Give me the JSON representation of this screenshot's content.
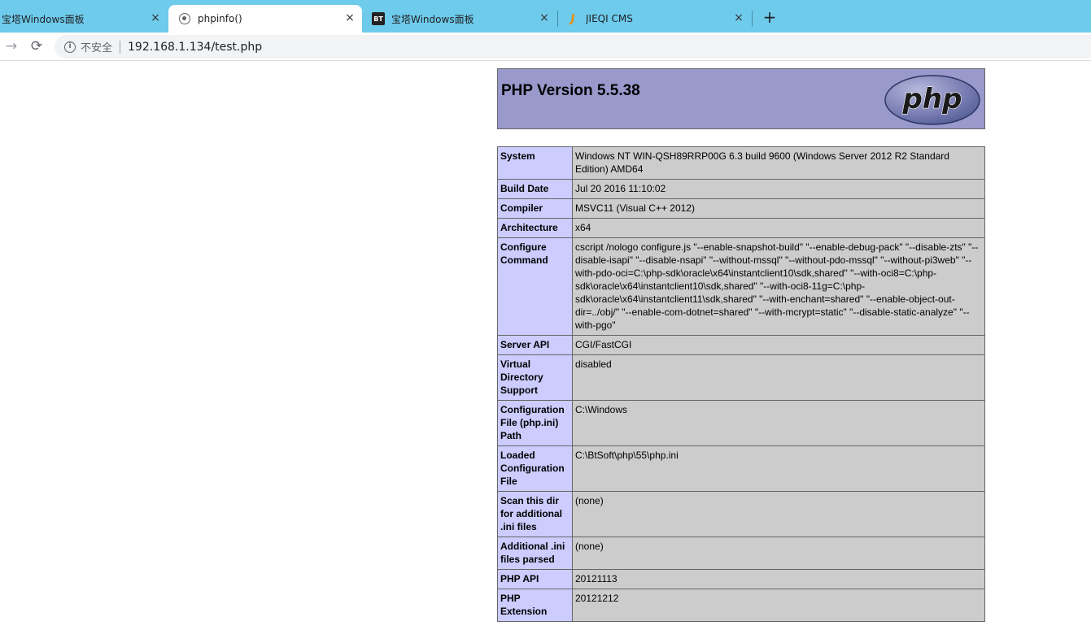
{
  "tabs": [
    {
      "title": "宝塔Windows面板",
      "icon": "none"
    },
    {
      "title": "phpinfo()",
      "icon": "globe-icon"
    },
    {
      "title": "宝塔Windows面板",
      "icon": "bt-icon"
    },
    {
      "title": "JIEQI CMS",
      "icon": "jieqi-icon"
    }
  ],
  "icons": {
    "close": "×",
    "new_tab": "+",
    "back": "←",
    "forward": "→",
    "reload": "⟳",
    "info": "i",
    "bt": "BT",
    "jieqi": "J"
  },
  "toolbar": {
    "security_label": "不安全",
    "url": "192.168.1.134/test.php"
  },
  "page": {
    "title": "PHP Version 5.5.38",
    "logo_text": "php",
    "rows": [
      {
        "key": "System",
        "value": "Windows NT WIN-QSH89RRP00G 6.3 build 9600 (Windows Server 2012 R2 Standard Edition) AMD64"
      },
      {
        "key": "Build Date",
        "value": "Jul 20 2016 11:10:02"
      },
      {
        "key": "Compiler",
        "value": "MSVC11 (Visual C++ 2012)"
      },
      {
        "key": "Architecture",
        "value": "x64"
      },
      {
        "key": "Configure Command",
        "value": "cscript /nologo configure.js \"--enable-snapshot-build\" \"--enable-debug-pack\" \"--disable-zts\" \"--disable-isapi\" \"--disable-nsapi\" \"--without-mssql\" \"--without-pdo-mssql\" \"--without-pi3web\" \"--with-pdo-oci=C:\\php-sdk\\oracle\\x64\\instantclient10\\sdk,shared\" \"--with-oci8=C:\\php-sdk\\oracle\\x64\\instantclient10\\sdk,shared\" \"--with-oci8-11g=C:\\php-sdk\\oracle\\x64\\instantclient11\\sdk,shared\" \"--with-enchant=shared\" \"--enable-object-out-dir=../obj/\" \"--enable-com-dotnet=shared\" \"--with-mcrypt=static\" \"--disable-static-analyze\" \"--with-pgo\""
      },
      {
        "key": "Server API",
        "value": "CGI/FastCGI"
      },
      {
        "key": "Virtual Directory Support",
        "value": "disabled"
      },
      {
        "key": "Configuration File (php.ini) Path",
        "value": "C:\\Windows"
      },
      {
        "key": "Loaded Configuration File",
        "value": "C:\\BtSoft\\php\\55\\php.ini"
      },
      {
        "key": "Scan this dir for additional .ini files",
        "value": "(none)"
      },
      {
        "key": "Additional .ini files parsed",
        "value": "(none)"
      },
      {
        "key": "PHP API",
        "value": "20121113"
      },
      {
        "key": "PHP Extension",
        "value": "20121212"
      }
    ]
  }
}
